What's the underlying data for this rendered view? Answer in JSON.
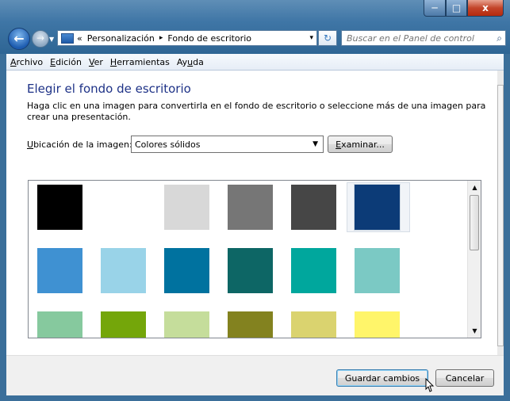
{
  "titlebar": {
    "minimize": "─",
    "maximize": "□",
    "close": "x"
  },
  "nav": {
    "back_glyph": "←",
    "forward_glyph": "→",
    "breadcrumb_prefix": "«",
    "crumbs": [
      "Personalización",
      "Fondo de escritorio"
    ],
    "crumb_sep": "▸",
    "dropdown_glyph": "▾",
    "refresh_glyph": "↻",
    "search_placeholder": "Buscar en el Panel de control",
    "search_glyph": "⌕"
  },
  "menu": {
    "items": [
      {
        "pre": "",
        "u": "A",
        "post": "rchivo"
      },
      {
        "pre": "",
        "u": "E",
        "post": "dición"
      },
      {
        "pre": "",
        "u": "V",
        "post": "er"
      },
      {
        "pre": "",
        "u": "H",
        "post": "erramientas"
      },
      {
        "pre": "Ay",
        "u": "u",
        "post": "da"
      }
    ]
  },
  "content": {
    "heading": "Elegir el fondo de escritorio",
    "description": "Haga clic en una imagen para convertirla en el fondo de escritorio o seleccione más de una imagen para crear una presentación.",
    "location_label_u": "U",
    "location_label_rest": "bicación de la imagen:",
    "location_value": "Colores sólidos",
    "browse_u": "E",
    "browse_rest": "xaminar..."
  },
  "swatches": [
    "#000000",
    "#ffffff",
    "#d8d8d8",
    "#767676",
    "#464646",
    "#0c3b77",
    "#3f91d2",
    "#99d3e8",
    "#00729f",
    "#0d6665",
    "#00a79d",
    "#7bc9c4",
    "#86c99e",
    "#74a60a",
    "#c5dd9b",
    "#83821f",
    "#dad36f",
    "#fff56a"
  ],
  "selected_swatch": 5,
  "footer": {
    "save_label": "Guardar cambios",
    "cancel_label": "Cancelar"
  }
}
